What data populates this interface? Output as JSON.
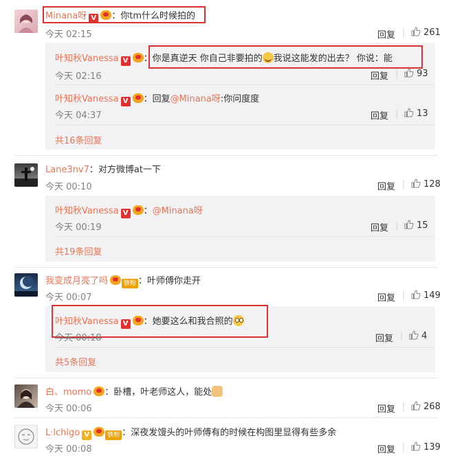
{
  "labels": {
    "reply": "回复",
    "sep": "|"
  },
  "comments": [
    {
      "user": "Minana呀",
      "text": "：你tm什么时候拍的",
      "time": "今天 02:15",
      "likes": "261",
      "replies": [
        {
          "user": "叶知秋Vanessa",
          "text_a": "：你是真逆天 你自己非要拍的",
          "text_b": "我说这能发的出去？ 你说：能",
          "time": "今天 02:16",
          "likes": "93"
        },
        {
          "user": "叶知秋Vanessa",
          "text_a": "：回复",
          "mention": "@Minana呀",
          "text_b": ":你问度度",
          "time": "今天 04:37",
          "likes": "13"
        }
      ],
      "more": "共16条回复"
    },
    {
      "user": "Lane3nv7",
      "text": "：对方微博at一下",
      "time": "今天 00:10",
      "likes": "128",
      "replies": [
        {
          "user": "叶知秋Vanessa",
          "text_a": "：",
          "mention": "@Minana呀",
          "time": "今天 00:19",
          "likes": "15"
        }
      ],
      "more": "共19条回复"
    },
    {
      "user": "我变成月亮了吗",
      "tag": "铁粉",
      "text": "：叶师傅你走开",
      "time": "今天 00:07",
      "likes": "149",
      "replies": [
        {
          "user": "叶知秋Vanessa",
          "text_a": "：她要这么和我合照的",
          "time": "今天 00:18",
          "likes": "4"
        }
      ],
      "more": "共5条回复"
    },
    {
      "user": "白、momo",
      "text": "：卧槽，叶老师这人，能处",
      "time": "今天 00:06",
      "likes": "268"
    },
    {
      "user": "L·lchigo",
      "tag": "铁粉",
      "text": "：深夜发馒头的叶师傅有的时候在构图里显得有些多余",
      "time": "今天 00:08",
      "likes": "139"
    }
  ],
  "colors": {
    "link": "#eb7350",
    "highlight": "#e0302f",
    "reply_bg": "#f2f2f5"
  }
}
